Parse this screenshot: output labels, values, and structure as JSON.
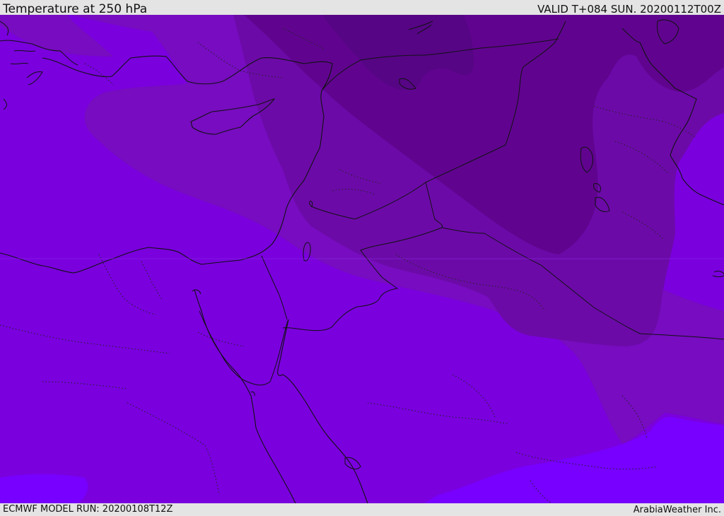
{
  "header": {
    "title": "Temperature at 250 hPa",
    "valid": "VALID T+084 SUN. 20200112T00Z"
  },
  "footer": {
    "model_run": "ECMWF MODEL RUN: 20200108T12Z",
    "credit": "ArabiaWeather Inc."
  },
  "colors": {
    "band_warmest": "#7700ff",
    "band_warm": "#7a00de",
    "band_mid": "#770cc0",
    "band_cool": "#6c0aa8",
    "band_cold": "#60048f",
    "band_coldest": "#560585",
    "coastline": "#111111",
    "borders": "#222222"
  }
}
